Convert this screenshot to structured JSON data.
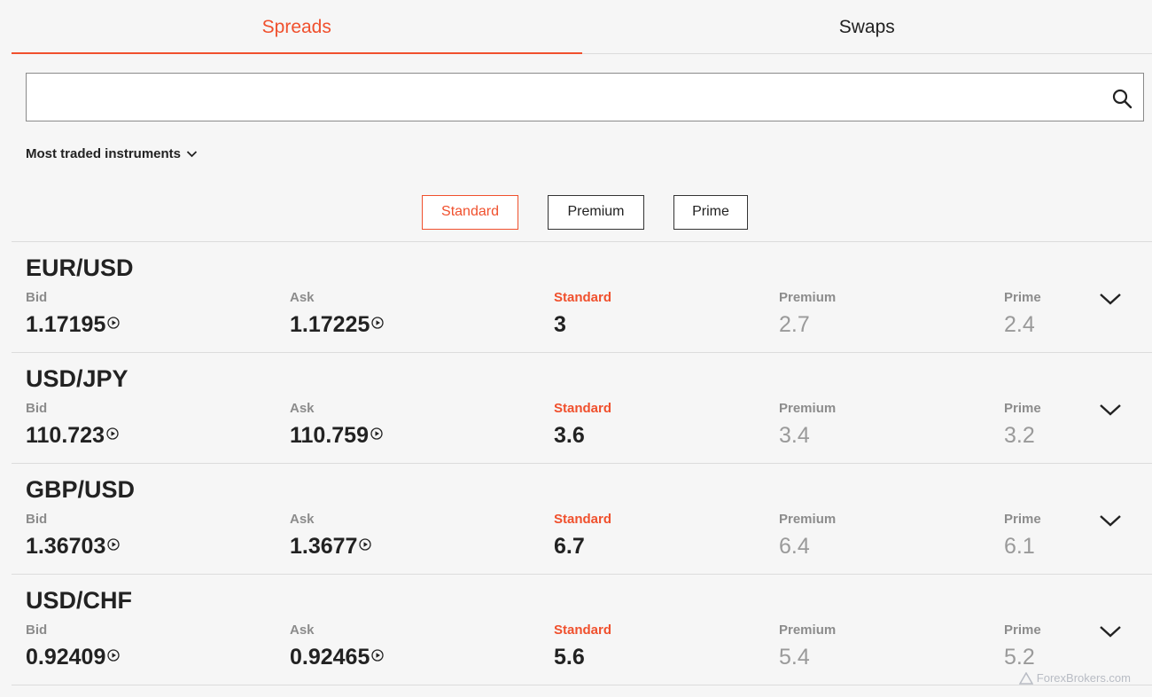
{
  "tabs": [
    {
      "label": "Spreads",
      "active": true
    },
    {
      "label": "Swaps",
      "active": false
    }
  ],
  "search": {
    "value": "",
    "icon": "search-icon"
  },
  "filter": {
    "label": "Most traded instruments"
  },
  "account_types": [
    {
      "label": "Standard",
      "active": true
    },
    {
      "label": "Premium",
      "active": false
    },
    {
      "label": "Prime",
      "active": false
    }
  ],
  "columns": {
    "bid": "Bid",
    "ask": "Ask",
    "standard": "Standard",
    "premium": "Premium",
    "prime": "Prime"
  },
  "instruments": [
    {
      "pair": "EUR/USD",
      "bid": "1.17195",
      "ask": "1.17225",
      "standard": "3",
      "premium": "2.7",
      "prime": "2.4"
    },
    {
      "pair": "USD/JPY",
      "bid": "110.723",
      "ask": "110.759",
      "standard": "3.6",
      "premium": "3.4",
      "prime": "3.2"
    },
    {
      "pair": "GBP/USD",
      "bid": "1.36703",
      "ask": "1.3677",
      "standard": "6.7",
      "premium": "6.4",
      "prime": "6.1"
    },
    {
      "pair": "USD/CHF",
      "bid": "0.92409",
      "ask": "0.92465",
      "standard": "5.6",
      "premium": "5.4",
      "prime": "5.2"
    }
  ],
  "colors": {
    "accent": "#f0502d",
    "muted": "#9a9a9a"
  },
  "watermark": "ForexBrokers.com"
}
